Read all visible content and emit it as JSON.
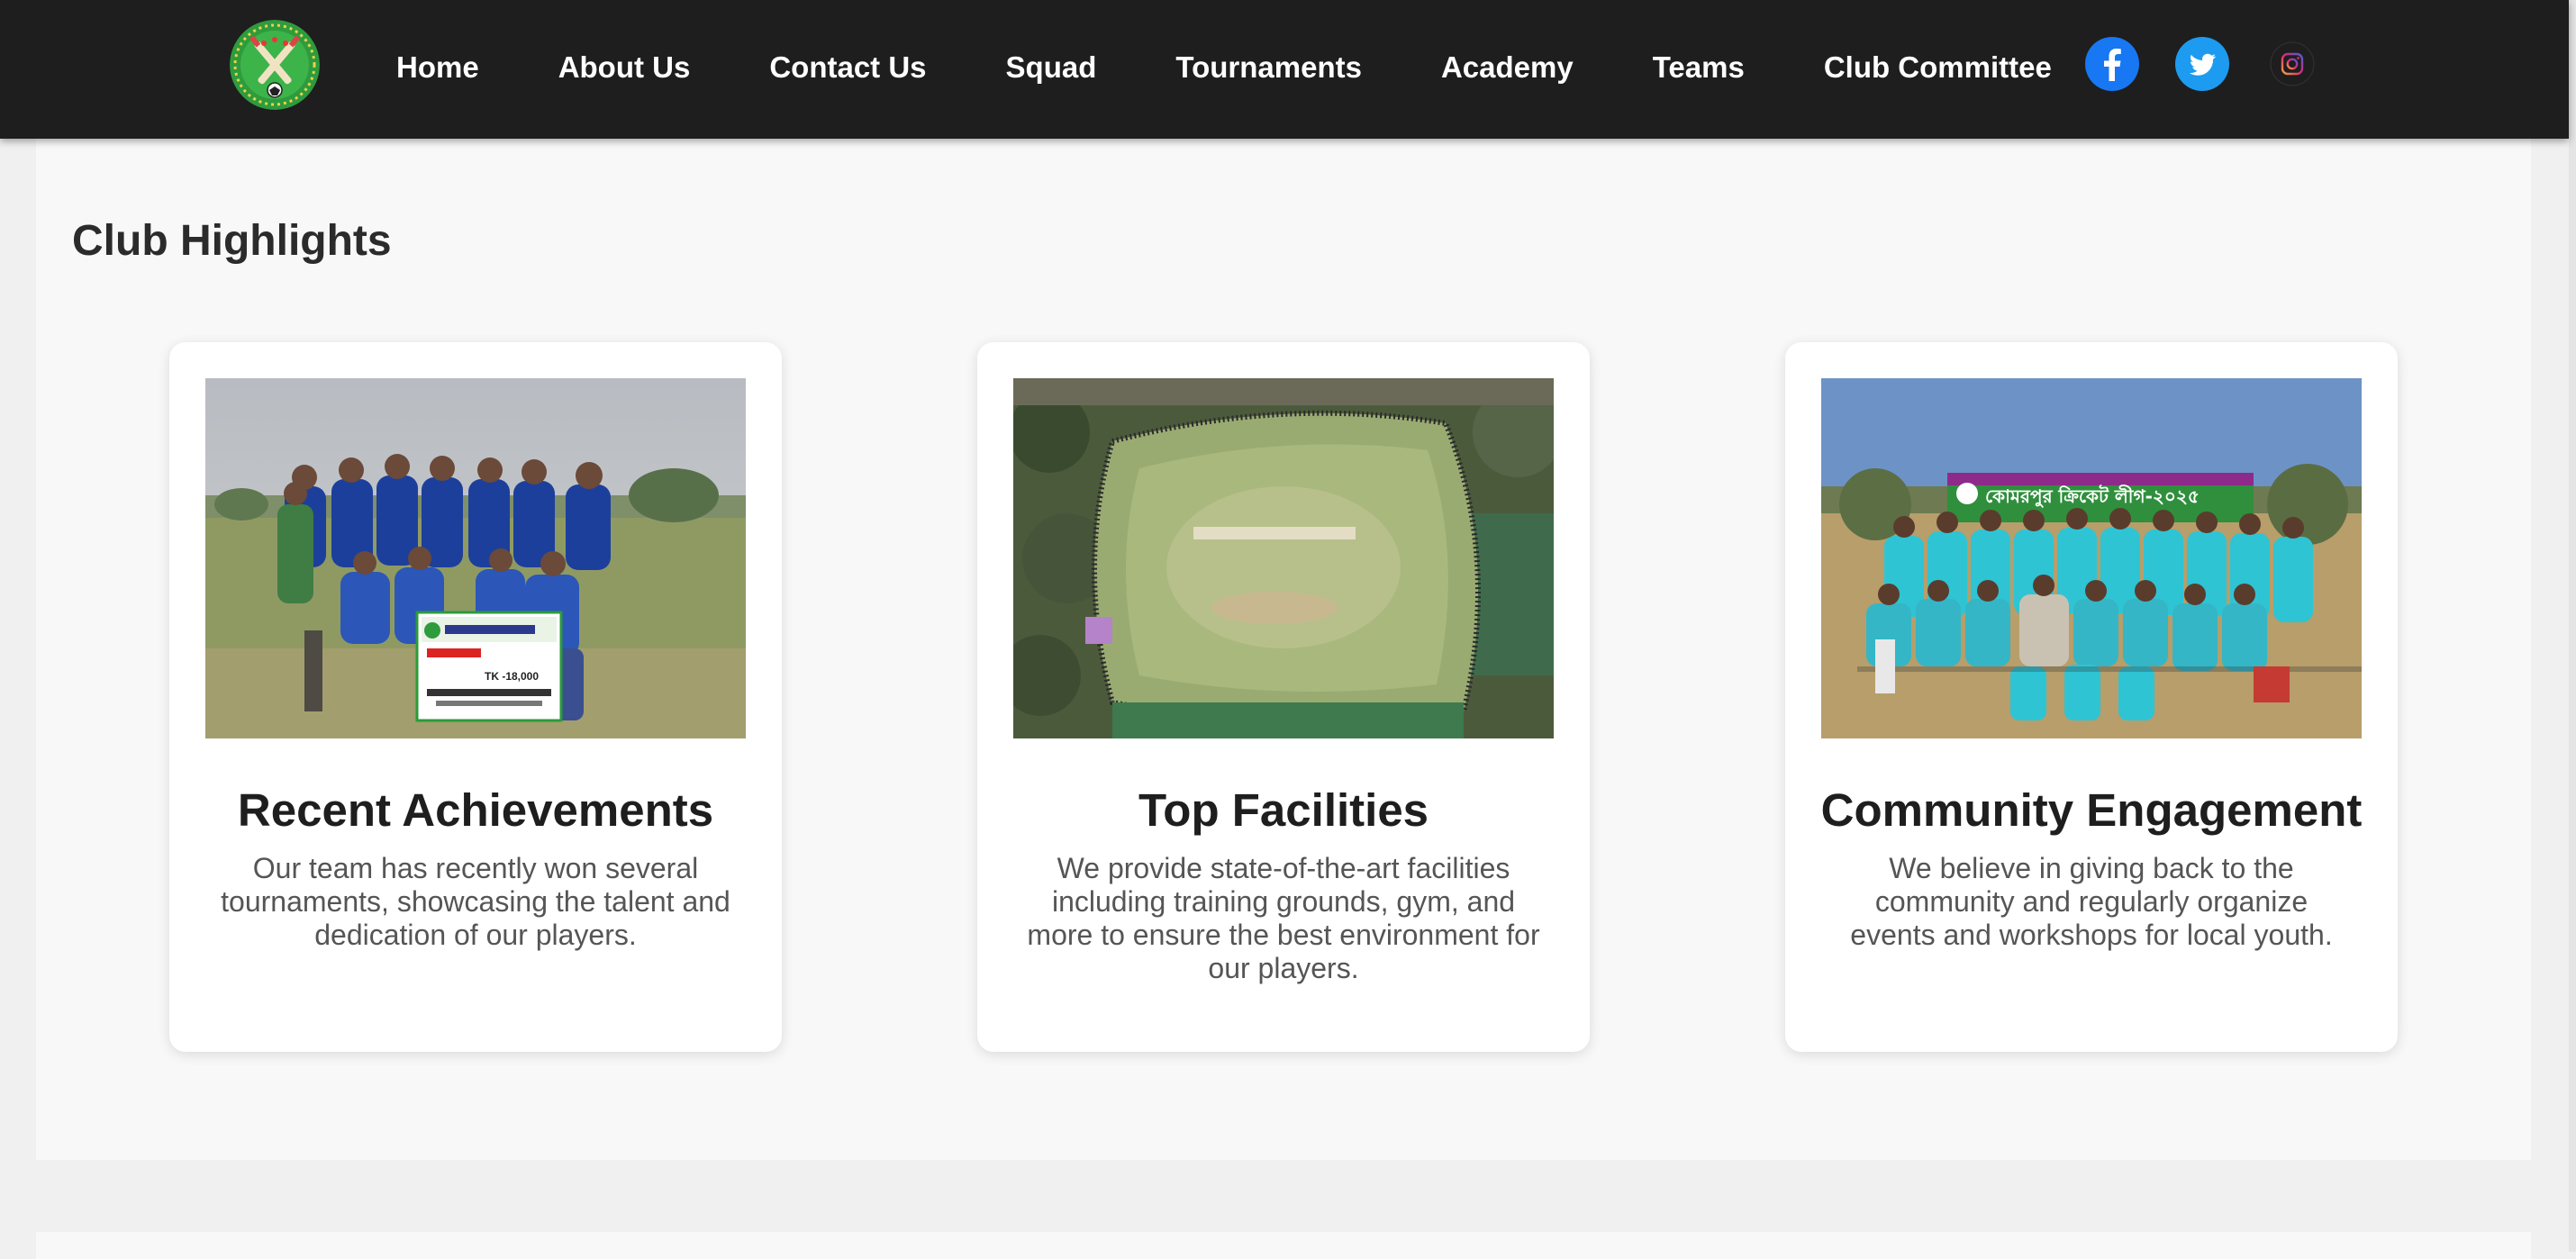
{
  "nav": {
    "items": [
      {
        "label": "Home"
      },
      {
        "label": "About Us"
      },
      {
        "label": "Contact Us"
      },
      {
        "label": "Squad"
      },
      {
        "label": "Tournaments"
      },
      {
        "label": "Academy"
      },
      {
        "label": "Teams"
      },
      {
        "label": "Club Committee"
      }
    ],
    "social": [
      "facebook-icon",
      "twitter-icon",
      "instagram-icon"
    ]
  },
  "highlights": {
    "title": "Club Highlights",
    "cards": [
      {
        "title": "Recent Achievements",
        "text": "Our team has recently won several tournaments, showcasing the talent and dedication of our players.",
        "image": "team-trophy-photo",
        "banner_text": "TK -18,000"
      },
      {
        "title": "Top Facilities",
        "text": "We provide state-of-the-art facilities including training grounds, gym, and more to ensure the best environment for our players.",
        "image": "aerial-ground-photo"
      },
      {
        "title": "Community Engagement",
        "text": "We believe in giving back to the community and regularly organize events and workshops for local youth.",
        "image": "team-banner-photo",
        "banner_text": "কোমরপুর ক্রিকেট লীগ-২০২৫"
      }
    ]
  },
  "colors": {
    "navbar": "#1e1e1e",
    "facebook": "#1877f2",
    "twitter": "#1d9bf0",
    "jersey_blue": "#1d3f9c",
    "jersey_teal": "#2ec4d4"
  }
}
